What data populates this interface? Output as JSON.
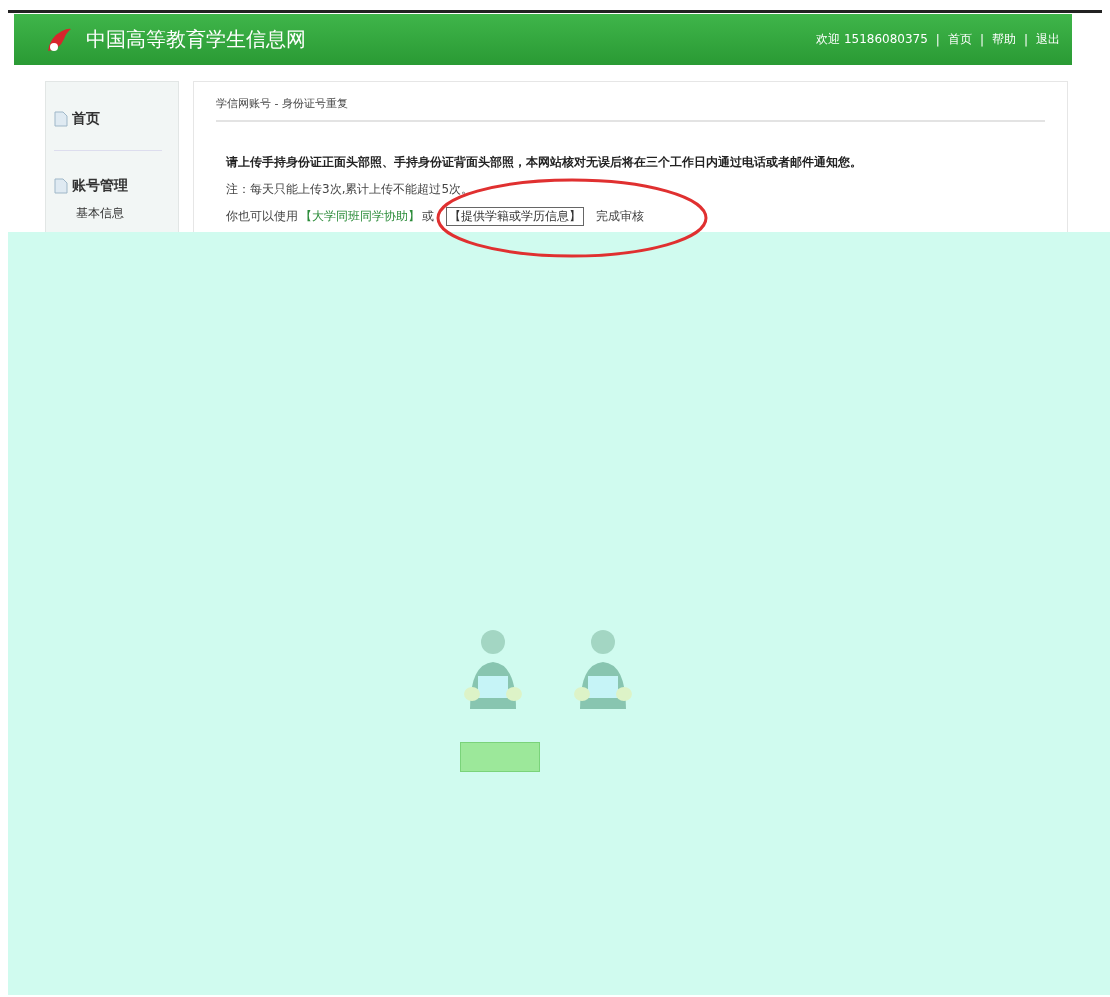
{
  "header": {
    "site_title": "中国高等教育学生信息网",
    "welcome": "欢迎 15186080375",
    "separator": "|",
    "links": [
      "首页",
      "帮助",
      "退出"
    ]
  },
  "sidebar": {
    "sections": [
      {
        "title": "首页"
      },
      {
        "title": "账号管理",
        "items": [
          "基本信息"
        ]
      }
    ]
  },
  "main": {
    "breadcrumb": "学信网账号 - 身份证号重复",
    "instruction": "请上传手持身份证正面头部照、手持身份证背面头部照，本网站核对无误后将在三个工作日内通过电话或者邮件通知您。",
    "note": "注：每天只能上传3次,累计上传不能超过5次。",
    "alt_line": {
      "prefix": "你也可以使用",
      "link": "【大学同班同学协助】",
      "joiner": "或",
      "boxed_link": "【提供学籍或学历信息】",
      "suffix": "完成审核"
    }
  }
}
